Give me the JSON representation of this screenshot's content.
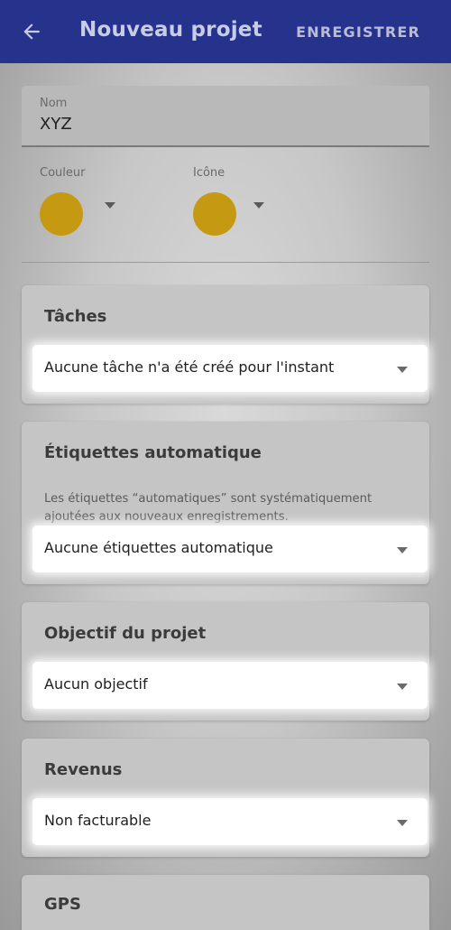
{
  "appbar": {
    "title": "Nouveau projet",
    "save_label": "ENREGISTRER",
    "back_icon": "arrow-back-icon"
  },
  "form": {
    "name": {
      "label": "Nom",
      "value": "XYZ"
    },
    "color": {
      "label": "Couleur",
      "swatch": "#c59a12"
    },
    "icon": {
      "label": "Icône",
      "swatch": "#c59a12"
    }
  },
  "sections": {
    "tasks": {
      "title": "Tâches",
      "value": "Aucune tâche n'a été créé pour l'instant"
    },
    "auto_tags": {
      "title": "Étiquettes automatique",
      "description": "Les étiquettes “automatiques” sont systématiquement ajoutées aux nouveaux enregistrements.",
      "value": "Aucune étiquettes automatique"
    },
    "goal": {
      "title": "Objectif du projet",
      "value": "Aucun objectif"
    },
    "revenue": {
      "title": "Revenus",
      "value": "Non facturable"
    },
    "gps": {
      "title": "GPS"
    }
  },
  "colors": {
    "appbar": "#26338c",
    "swatch": "#c59a12"
  }
}
